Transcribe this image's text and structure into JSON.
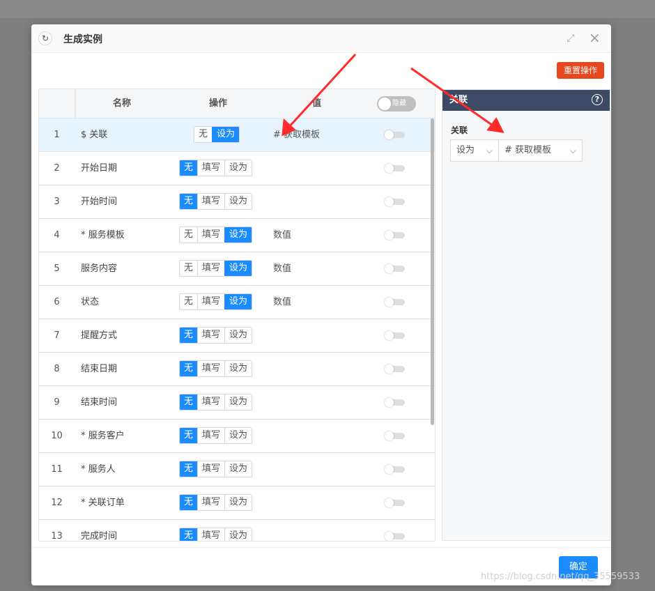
{
  "modal": {
    "title": "生成实例",
    "reset_label": "重置操作",
    "confirm_label": "确定"
  },
  "table": {
    "columns": [
      "名称",
      "操作",
      "值"
    ],
    "header_toggle_label": "隐藏",
    "rows": [
      {
        "num": "1",
        "name": "$ 关联",
        "ops": [
          "无",
          "设为"
        ],
        "active": "设为",
        "value": "# 获取模板",
        "selected": true
      },
      {
        "num": "2",
        "name": "开始日期",
        "ops": [
          "无",
          "填写",
          "设为"
        ],
        "active": "无",
        "value": ""
      },
      {
        "num": "3",
        "name": "开始时间",
        "ops": [
          "无",
          "填写",
          "设为"
        ],
        "active": "无",
        "value": ""
      },
      {
        "num": "4",
        "name": "* 服务模板",
        "ops": [
          "无",
          "填写",
          "设为"
        ],
        "active": "设为",
        "value": "数值"
      },
      {
        "num": "5",
        "name": "服务内容",
        "ops": [
          "无",
          "填写",
          "设为"
        ],
        "active": "设为",
        "value": "数值"
      },
      {
        "num": "6",
        "name": "状态",
        "ops": [
          "无",
          "填写",
          "设为"
        ],
        "active": "设为",
        "value": "数值"
      },
      {
        "num": "7",
        "name": "提醒方式",
        "ops": [
          "无",
          "填写",
          "设为"
        ],
        "active": "无",
        "value": ""
      },
      {
        "num": "8",
        "name": "结束日期",
        "ops": [
          "无",
          "填写",
          "设为"
        ],
        "active": "无",
        "value": ""
      },
      {
        "num": "9",
        "name": "结束时间",
        "ops": [
          "无",
          "填写",
          "设为"
        ],
        "active": "无",
        "value": ""
      },
      {
        "num": "10",
        "name": "* 服务客户",
        "ops": [
          "无",
          "填写",
          "设为"
        ],
        "active": "无",
        "value": ""
      },
      {
        "num": "11",
        "name": "* 服务人",
        "ops": [
          "无",
          "填写",
          "设为"
        ],
        "active": "无",
        "value": ""
      },
      {
        "num": "12",
        "name": "* 关联订单",
        "ops": [
          "无",
          "填写",
          "设为"
        ],
        "active": "无",
        "value": ""
      },
      {
        "num": "13",
        "name": "完成时间",
        "ops": [
          "无",
          "填写",
          "设为"
        ],
        "active": "无",
        "value": ""
      }
    ]
  },
  "side_panel": {
    "title": "关联",
    "field_label": "关联",
    "mode_value": "设为",
    "template_value": "# 获取模板"
  },
  "watermark": "https://blog.csdn.net/qq_35559533",
  "colors": {
    "primary": "#1a8cff",
    "danger": "#e8461c",
    "arrow": "#ff2a2a",
    "side_header": "#3d4a66"
  }
}
